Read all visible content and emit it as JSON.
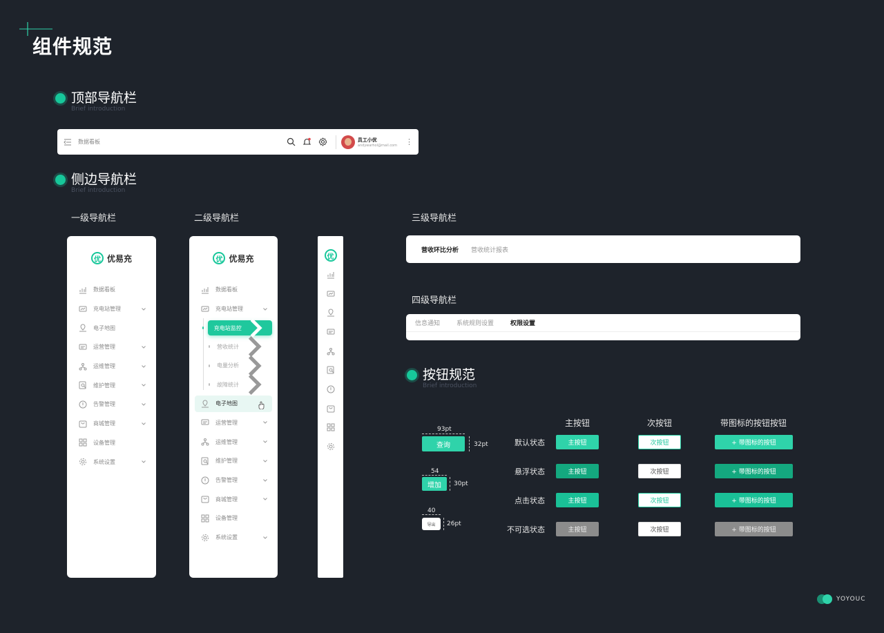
{
  "page": {
    "title": "组件规范"
  },
  "sections": {
    "topnav": {
      "title": "顶部导航栏",
      "sub": "Brief introduction"
    },
    "sidenav": {
      "title": "侧边导航栏",
      "sub": "Brief introduction"
    },
    "buttons": {
      "title": "按钮规范",
      "sub": "Brief introduction"
    }
  },
  "topbar": {
    "breadcrumb": "数据看板",
    "user_name": "员工小优",
    "user_email": "andywarhol@mail.com",
    "more": "⋮"
  },
  "labels": {
    "level1": "一级导航栏",
    "level2": "二级导航栏",
    "level3": "三级导航栏",
    "level4": "四级导航栏"
  },
  "logo": {
    "mark": "优",
    "text": "优易充"
  },
  "nav1": [
    {
      "label": "数据看板",
      "icon": "chart-icon",
      "chev": false
    },
    {
      "label": "充电站管理",
      "icon": "monitor-icon",
      "chev": true
    },
    {
      "label": "电子地图",
      "icon": "map-icon",
      "chev": false
    },
    {
      "label": "运营管理",
      "icon": "message-icon",
      "chev": true
    },
    {
      "label": "运维管理",
      "icon": "network-icon",
      "chev": true
    },
    {
      "label": "维护管理",
      "icon": "search-doc-icon",
      "chev": true
    },
    {
      "label": "告警管理",
      "icon": "alert-icon",
      "chev": true
    },
    {
      "label": "商城管理",
      "icon": "shop-icon",
      "chev": true
    },
    {
      "label": "设备管理",
      "icon": "grid-icon",
      "chev": false
    },
    {
      "label": "系统设置",
      "icon": "gear-icon",
      "chev": true
    }
  ],
  "nav2": {
    "top": [
      {
        "label": "数据看板"
      },
      {
        "label": "充电站管理"
      }
    ],
    "sub": [
      {
        "label": "充电站监控",
        "active": true
      },
      {
        "label": "营收统计"
      },
      {
        "label": "电量分析"
      },
      {
        "label": "故障统计"
      }
    ],
    "rest": [
      {
        "label": "电子地图"
      },
      {
        "label": "运营管理"
      },
      {
        "label": "运维管理"
      },
      {
        "label": "维护管理"
      },
      {
        "label": "告警管理"
      },
      {
        "label": "商城管理"
      },
      {
        "label": "设备管理"
      },
      {
        "label": "系统设置"
      }
    ]
  },
  "tabs3": [
    "营收环比分析",
    "营收统计报表"
  ],
  "tabs4": [
    "信息通知",
    "系统规则设置",
    "权限设置"
  ],
  "btn_spec": {
    "query": {
      "label": "查询",
      "w": "93pt",
      "h": "32pt"
    },
    "add": {
      "label": "增加",
      "w": "54",
      "h": "30pt"
    },
    "export": {
      "label": "导出",
      "w": "40",
      "h": "26pt"
    }
  },
  "btn_table": {
    "cols": [
      "主按钮",
      "次按钮",
      "带图标的按钮按钮"
    ],
    "rows": [
      "默认状态",
      "悬浮状态",
      "点击状态",
      "不可选状态"
    ],
    "primary": "主按钮",
    "secondary": "次按钮",
    "icon_btn": "+ 带图标的按钮"
  },
  "brand": {
    "text": "YOYOUC"
  },
  "colors": {
    "accent": "#17c79a",
    "bg": "#1e232b"
  }
}
